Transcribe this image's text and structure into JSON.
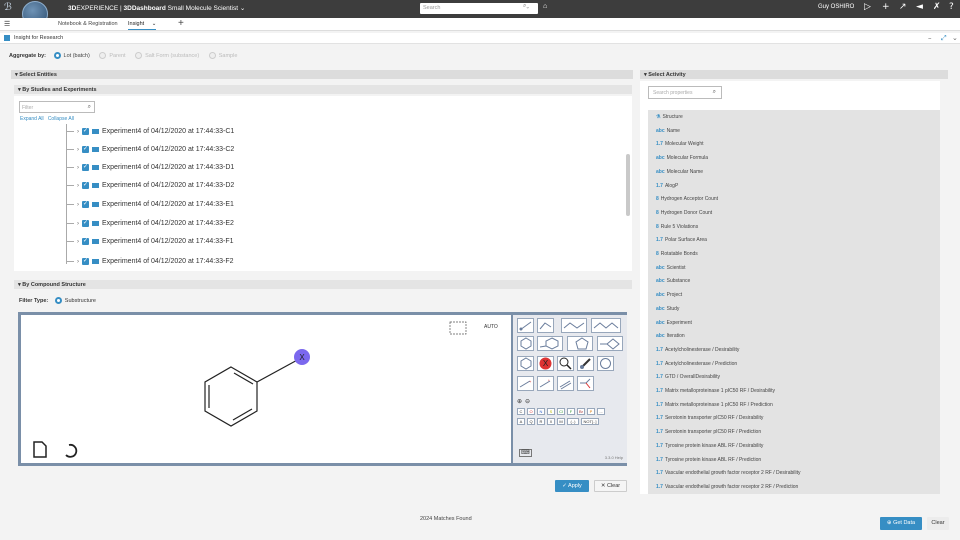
{
  "topbar": {
    "brand_bold": "3D",
    "brand_rest": "EXPERIENCE",
    "separator": " | ",
    "dashboard_bold": "3DDashboard",
    "dashboard_name": "Small Molecule Scientist",
    "dropdown_icon": "chevron-down-icon",
    "compass_label": "V.R",
    "search_placeholder": "Search",
    "user": "Guy OSHIRO",
    "icons": [
      "share-icon",
      "plus-icon",
      "share-arrow-icon",
      "broadcast-icon",
      "tools-icon",
      "help-icon"
    ]
  },
  "tabs": {
    "items": [
      "Notebook & Registration",
      "Insight"
    ],
    "active": "Insight"
  },
  "widget": {
    "title": "Insight for Research"
  },
  "aggregate": {
    "label": "Aggregate by:",
    "options": [
      {
        "label": "Lot (batch)",
        "selected": true,
        "enabled": true
      },
      {
        "label": "Parent",
        "selected": false,
        "enabled": false
      },
      {
        "label": "Salt Form (substance)",
        "selected": false,
        "enabled": false
      },
      {
        "label": "Sample",
        "selected": false,
        "enabled": false
      }
    ]
  },
  "select_entities": {
    "title": "Select Entities",
    "studies_title": "By Studies and Experiments",
    "filter_placeholder": "Filter",
    "expand_all": "Expand All",
    "collapse_all": "Collapse All",
    "tree_items": [
      "Experiment4 of 04/12/2020 at 17:44:33-C1",
      "Experiment4 of 04/12/2020 at 17:44:33-C2",
      "Experiment4 of 04/12/2020 at 17:44:33-D1",
      "Experiment4 of 04/12/2020 at 17:44:33-D2",
      "Experiment4 of 04/12/2020 at 17:44:33-E1",
      "Experiment4 of 04/12/2020 at 17:44:33-E2",
      "Experiment4 of 04/12/2020 at 17:44:33-F1",
      "Experiment4 of 04/12/2020 at 17:44:33-F2"
    ],
    "compound_title": "By Compound Structure",
    "filter_type_label": "Filter Type:",
    "filter_type_value": "Substructure",
    "editor_version": "3.3.0  Help",
    "auto_label": "AUTO",
    "atom_buttons": [
      "C",
      "O",
      "N",
      "S",
      "Cl",
      "F",
      "Br",
      "P",
      "..."
    ],
    "query_buttons": [
      "A",
      "Q",
      "R",
      "X",
      "M",
      "(..)",
      "NOT[..]"
    ],
    "apply_label": "Apply",
    "clear_label": "Clear"
  },
  "select_activity": {
    "title": "Select Activity",
    "search_placeholder": "Search properties",
    "items": [
      {
        "type": "",
        "label": "Structure"
      },
      {
        "type": "abc",
        "label": "Name"
      },
      {
        "type": "1.7",
        "label": "Molecular Weight"
      },
      {
        "type": "abc",
        "label": "Molecular Formula"
      },
      {
        "type": "abc",
        "label": "Molecular Name"
      },
      {
        "type": "1.7",
        "label": "AlogP"
      },
      {
        "type": "8",
        "label": "Hydrogen Acceptor Count"
      },
      {
        "type": "8",
        "label": "Hydrogen Donor Count"
      },
      {
        "type": "8",
        "label": "Rule 5 Violations"
      },
      {
        "type": "1.7",
        "label": "Polar Surface Area"
      },
      {
        "type": "8",
        "label": "Rotatable Bonds"
      },
      {
        "type": "abc",
        "label": "Scientist"
      },
      {
        "type": "abc",
        "label": "Substance"
      },
      {
        "type": "abc",
        "label": "Project"
      },
      {
        "type": "abc",
        "label": "Study"
      },
      {
        "type": "abc",
        "label": "Experiment"
      },
      {
        "type": "abc",
        "label": "Iteration"
      },
      {
        "type": "1.7",
        "label": "Acetylcholinesterase / Desirability"
      },
      {
        "type": "1.7",
        "label": "Acetylcholinesterase / Prediction"
      },
      {
        "type": "1.7",
        "label": "GTD / OverallDesirability"
      },
      {
        "type": "1.7",
        "label": "Matrix metalloproteinase 1 pIC50 RF / Desirability"
      },
      {
        "type": "1.7",
        "label": "Matrix metalloproteinase 1 pIC50 RF / Prediction"
      },
      {
        "type": "1.7",
        "label": "Serotonin transporter pIC50 RF / Desirability"
      },
      {
        "type": "1.7",
        "label": "Serotonin transporter pIC50 RF / Prediction"
      },
      {
        "type": "1.7",
        "label": "Tyrosine protein kinase ABL RF / Desirability"
      },
      {
        "type": "1.7",
        "label": "Tyrosine protein kinase ABL RF / Prediction"
      },
      {
        "type": "1.7",
        "label": "Vascular endothelial growth factor receptor 2 RF / Desirability"
      },
      {
        "type": "1.7",
        "label": "Vascular endothelial growth factor receptor 2 RF / Prediction"
      }
    ]
  },
  "footer": {
    "matches": "2024 Matches Found",
    "get_data": "Get Data",
    "clear": "Clear"
  },
  "colors": {
    "accent": "#368ec4",
    "topbar": "#3d3d3d",
    "x_atom": "#7b68ee"
  }
}
